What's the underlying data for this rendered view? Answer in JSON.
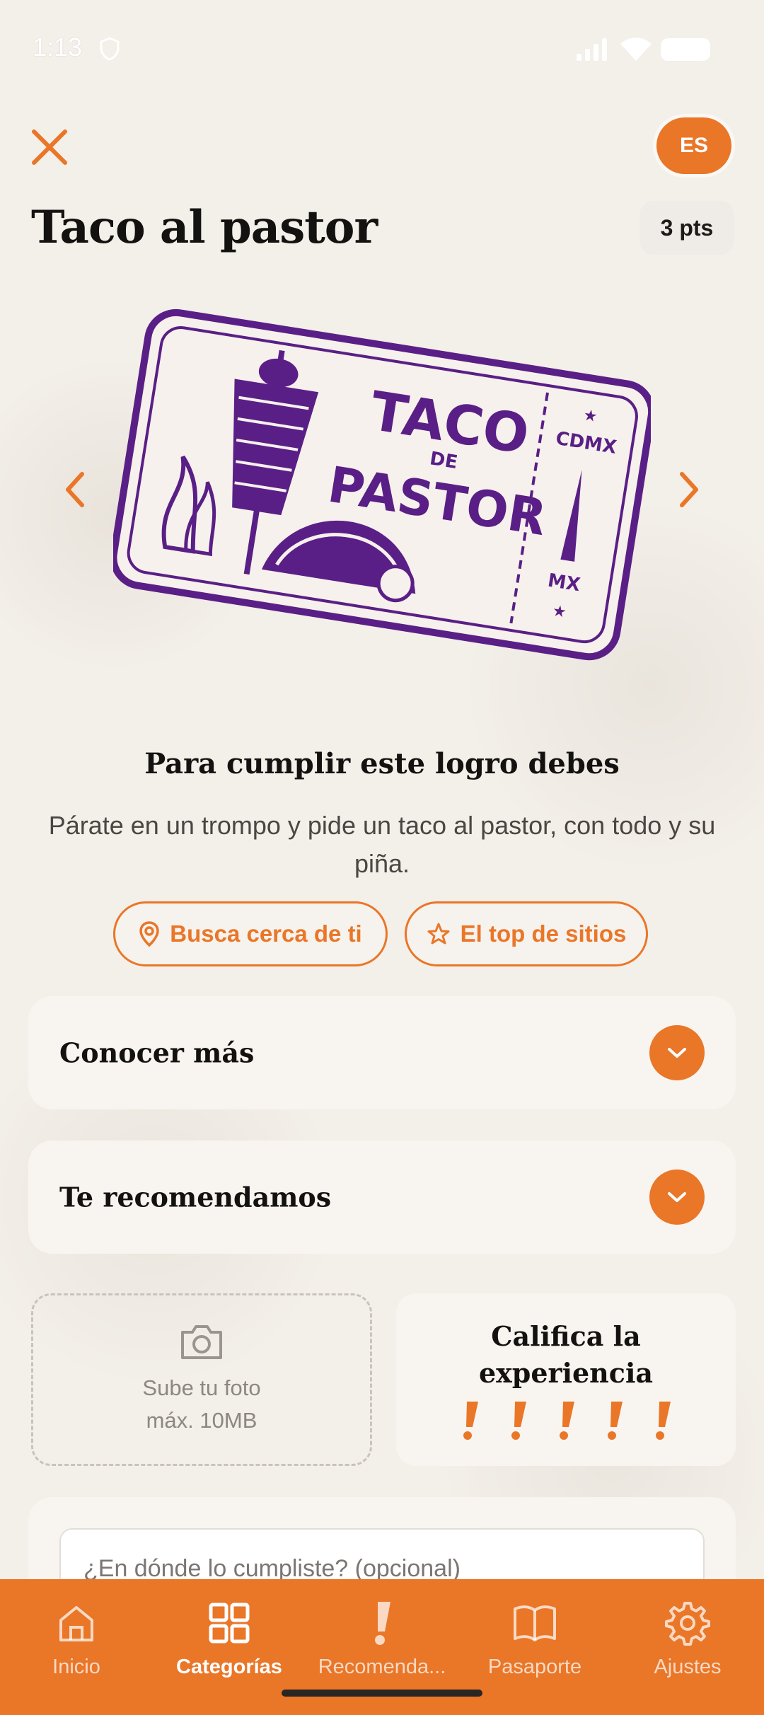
{
  "status_bar": {
    "time": "1:13"
  },
  "header": {
    "title": "Taco al pastor",
    "language": "ES",
    "points": "3 pts"
  },
  "stamp": {
    "title_top": "TACO",
    "title_mid": "DE",
    "title_bottom": "PASTOR",
    "side_top": "CDMX",
    "side_bottom": "MX"
  },
  "achievement": {
    "heading": "Para cumplir este logro debes",
    "description": "Párate en un trompo y pide un taco al pastor, con todo y su piña.",
    "nearby_button": "Busca cerca de ti",
    "top_button": "El top de sitios"
  },
  "sections": {
    "learn_more": "Conocer más",
    "recommend": "Te recomendamos"
  },
  "upload": {
    "line1": "Sube tu foto",
    "line2": "máx. 10MB"
  },
  "rating": {
    "title": "Califica la experiencia",
    "max": 5
  },
  "comment": {
    "placeholder": "¿En dónde lo cumpliste? (opcional)"
  },
  "nav": [
    {
      "label": "Inicio",
      "icon": "home-icon",
      "active": false
    },
    {
      "label": "Categorías",
      "icon": "grid-icon",
      "active": true
    },
    {
      "label": "Recomenda...",
      "icon": "exclamation-icon",
      "active": false
    },
    {
      "label": "Pasaporte",
      "icon": "book-icon",
      "active": false
    },
    {
      "label": "Ajustes",
      "icon": "gear-icon",
      "active": false
    }
  ],
  "colors": {
    "accent": "#ea7628",
    "stamp": "#5a1f86",
    "background": "#f3efe9"
  }
}
